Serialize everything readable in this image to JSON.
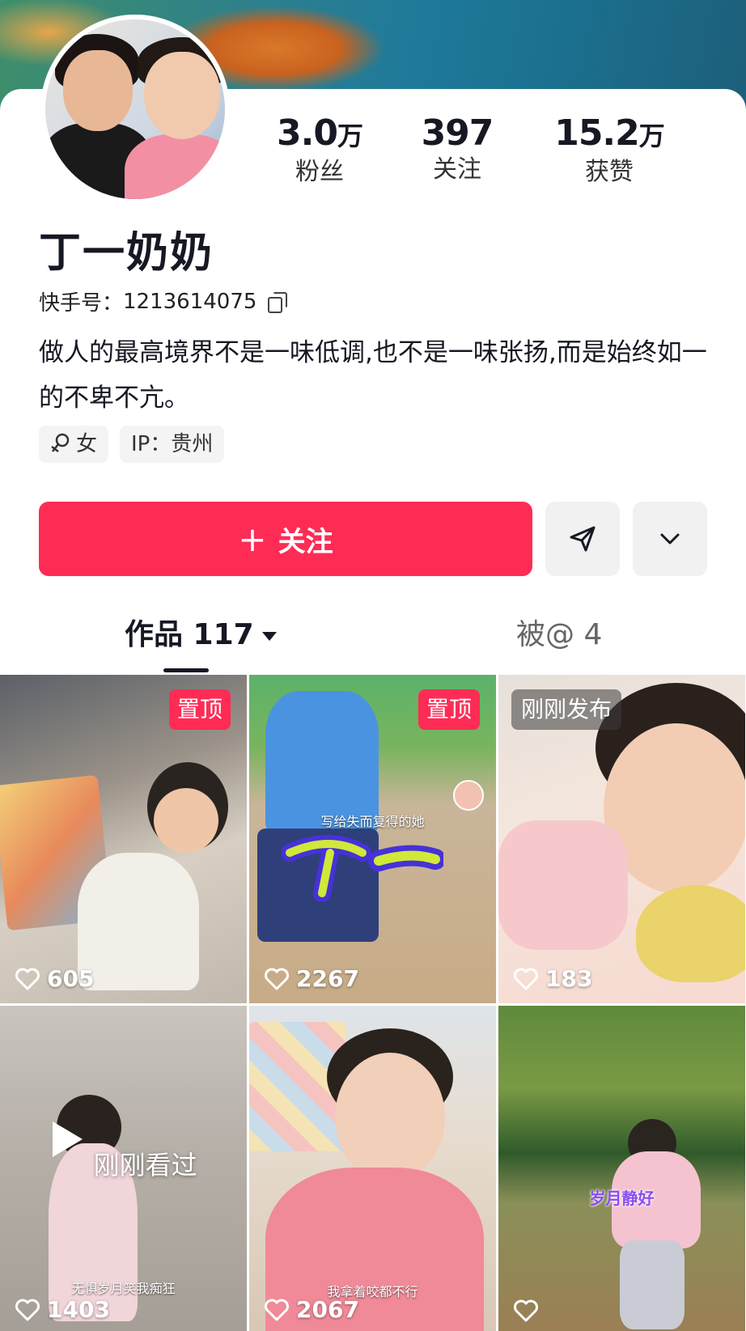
{
  "profile": {
    "name": "丁一奶奶",
    "uid_label": "快手号：",
    "uid_value": "1213614075",
    "bio": "做人的最高境界不是一味低调,也不是一味张扬,而是始终如一的不卑不亢。",
    "gender": "女",
    "ip": "IP：贵州"
  },
  "stats": {
    "fans": {
      "value": "3.0",
      "unit": "万",
      "label": "粉丝"
    },
    "following": {
      "value": "397",
      "unit": "",
      "label": "关注"
    },
    "likes": {
      "value": "15.2",
      "unit": "万",
      "label": "获赞"
    }
  },
  "actions": {
    "follow_label": "关注",
    "share_icon": "send-icon",
    "more_icon": "chevron-down-icon"
  },
  "tabs": {
    "works_label": "作品 117",
    "mentions_label": "被@ 4"
  },
  "videos": [
    {
      "likes": "605",
      "badge": "置顶"
    },
    {
      "likes": "2267",
      "badge": "置顶",
      "caption": "写给失而复得的她",
      "overlay_text": "丁一"
    },
    {
      "likes": "183",
      "badge": "刚刚发布"
    },
    {
      "likes": "1403",
      "status": "刚刚看过",
      "caption": "无惧岁月笑我痴狂"
    },
    {
      "likes": "2067",
      "caption": "我拿着咬都不行"
    },
    {
      "likes": "",
      "caption": "岁月静好"
    }
  ],
  "colors": {
    "accent": "#fe2c55",
    "text": "#161823"
  }
}
